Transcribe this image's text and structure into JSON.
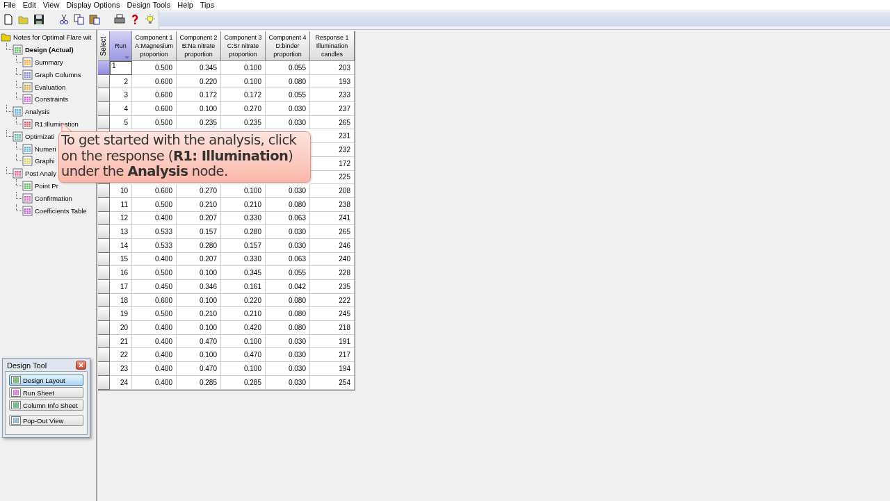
{
  "menu": [
    "File",
    "Edit",
    "View",
    "Display Options",
    "Design Tools",
    "Help",
    "Tips"
  ],
  "tree": {
    "label": "Notes for Optimal Flare wit",
    "children": [
      {
        "label": "Design (Actual)",
        "current": true,
        "children": [
          {
            "label": "Summary"
          },
          {
            "label": "Graph Columns"
          },
          {
            "label": "Evaluation"
          },
          {
            "label": "Constraints"
          }
        ]
      },
      {
        "label": "Analysis",
        "current": false,
        "children": [
          {
            "label": "R1:Illumination"
          }
        ]
      },
      {
        "label": "Optimizati",
        "current": false,
        "children": [
          {
            "label": "Numeri"
          },
          {
            "label": "Graphi"
          }
        ]
      },
      {
        "label": "Post Analy",
        "current": false,
        "children": [
          {
            "label": "Point Pr"
          },
          {
            "label": "Confirmation"
          },
          {
            "label": "Coefficients Table"
          }
        ]
      }
    ]
  },
  "table": {
    "select_header": "Select",
    "columns": [
      {
        "lines": [
          "Run"
        ],
        "sorted": true
      },
      {
        "lines": [
          "Component 1",
          "A:Magnesium",
          "proportion"
        ],
        "sorted": false
      },
      {
        "lines": [
          "Component 2",
          "B:Na nitrate",
          "proportion"
        ],
        "sorted": false
      },
      {
        "lines": [
          "Component 3",
          "C:Sr nitrate",
          "proportion"
        ],
        "sorted": false
      },
      {
        "lines": [
          "Component 4",
          "D:binder",
          "proportion"
        ],
        "sorted": false
      },
      {
        "lines": [
          "Response 1",
          "Illumination",
          "candles"
        ],
        "sorted": false
      }
    ],
    "rows": [
      {
        "kind": "full",
        "selected": true,
        "cells": [
          "1",
          "0.500",
          "0.345",
          "0.100",
          "0.055",
          "203"
        ]
      },
      {
        "kind": "full",
        "selected": false,
        "cells": [
          "2",
          "0.600",
          "0.220",
          "0.100",
          "0.080",
          "193"
        ]
      },
      {
        "kind": "full",
        "selected": false,
        "cells": [
          "3",
          "0.600",
          "0.172",
          "0.172",
          "0.055",
          "233"
        ]
      },
      {
        "kind": "full",
        "selected": false,
        "cells": [
          "4",
          "0.600",
          "0.100",
          "0.270",
          "0.030",
          "237"
        ]
      },
      {
        "kind": "full",
        "selected": false,
        "cells": [
          "5",
          "0.500",
          "0.235",
          "0.235",
          "0.030",
          "265"
        ]
      },
      {
        "kind": "covered",
        "cells": [
          "231"
        ]
      },
      {
        "kind": "covered",
        "cells": [
          "232"
        ]
      },
      {
        "kind": "covered",
        "cells": [
          "172"
        ]
      },
      {
        "kind": "covered",
        "cells": [
          "225"
        ]
      },
      {
        "kind": "full",
        "selected": false,
        "cells": [
          "10",
          "0.600",
          "0.270",
          "0.100",
          "0.030",
          "208"
        ]
      },
      {
        "kind": "full",
        "selected": false,
        "cells": [
          "11",
          "0.500",
          "0.210",
          "0.210",
          "0.080",
          "238"
        ]
      },
      {
        "kind": "full",
        "selected": false,
        "cells": [
          "12",
          "0.400",
          "0.207",
          "0.330",
          "0.063",
          "241"
        ]
      },
      {
        "kind": "full",
        "selected": false,
        "cells": [
          "13",
          "0.533",
          "0.157",
          "0.280",
          "0.030",
          "265"
        ]
      },
      {
        "kind": "full",
        "selected": false,
        "cells": [
          "14",
          "0.533",
          "0.280",
          "0.157",
          "0.030",
          "246"
        ]
      },
      {
        "kind": "full",
        "selected": false,
        "cells": [
          "15",
          "0.400",
          "0.207",
          "0.330",
          "0.063",
          "240"
        ]
      },
      {
        "kind": "full",
        "selected": false,
        "cells": [
          "16",
          "0.500",
          "0.100",
          "0.345",
          "0.055",
          "228"
        ]
      },
      {
        "kind": "full",
        "selected": false,
        "cells": [
          "17",
          "0.450",
          "0.346",
          "0.161",
          "0.042",
          "235"
        ]
      },
      {
        "kind": "full",
        "selected": false,
        "cells": [
          "18",
          "0.600",
          "0.100",
          "0.220",
          "0.080",
          "222"
        ]
      },
      {
        "kind": "full",
        "selected": false,
        "cells": [
          "19",
          "0.500",
          "0.210",
          "0.210",
          "0.080",
          "245"
        ]
      },
      {
        "kind": "full",
        "selected": false,
        "cells": [
          "20",
          "0.400",
          "0.100",
          "0.420",
          "0.080",
          "218"
        ]
      },
      {
        "kind": "full",
        "selected": false,
        "cells": [
          "21",
          "0.400",
          "0.470",
          "0.100",
          "0.030",
          "191"
        ]
      },
      {
        "kind": "full",
        "selected": false,
        "cells": [
          "22",
          "0.400",
          "0.100",
          "0.470",
          "0.030",
          "217"
        ]
      },
      {
        "kind": "full",
        "selected": false,
        "cells": [
          "23",
          "0.400",
          "0.470",
          "0.100",
          "0.030",
          "194"
        ]
      },
      {
        "kind": "full",
        "selected": false,
        "cells": [
          "24",
          "0.400",
          "0.285",
          "0.285",
          "0.030",
          "254"
        ]
      }
    ]
  },
  "callout": {
    "text": "To get started with the analysis, click on the response (**R1: Illumination**) under the **Analysis** node."
  },
  "design_tool": {
    "title": "Design Tool",
    "buttons": [
      {
        "label": "Design Layout",
        "selected": true
      },
      {
        "label": "Run Sheet",
        "selected": false
      },
      {
        "label": "Column Info Sheet",
        "selected": false
      },
      {
        "label": "Pop-Out View",
        "selected": false
      }
    ]
  }
}
